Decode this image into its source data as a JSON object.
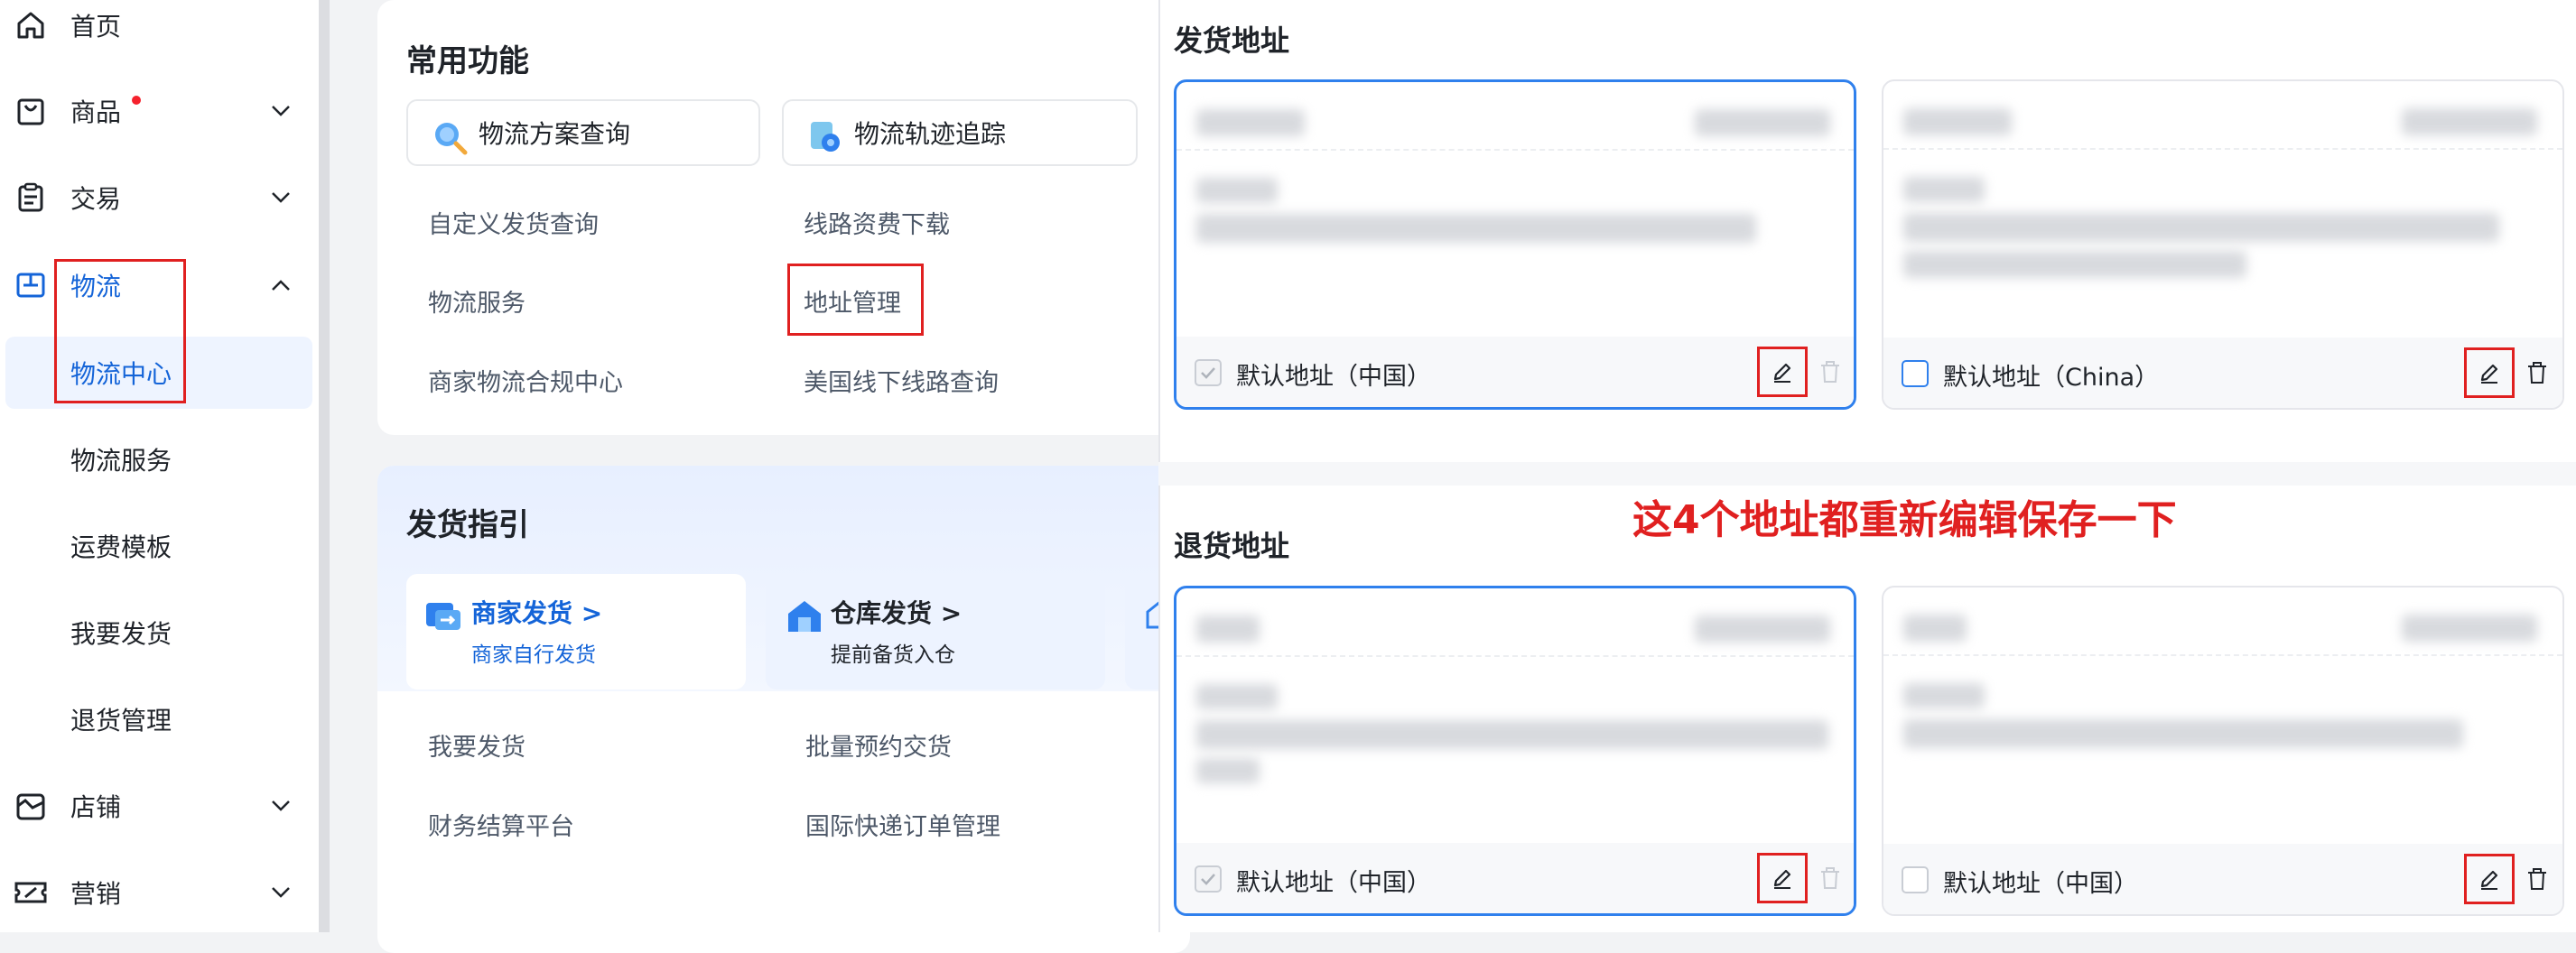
{
  "sidebar": {
    "items": [
      {
        "label": "首页",
        "icon": "home-icon"
      },
      {
        "label": "商品",
        "icon": "shopping-bag-icon",
        "has_dot": true
      },
      {
        "label": "交易",
        "icon": "clipboard-icon"
      },
      {
        "label": "物流",
        "icon": "logistics-box-icon",
        "active": true
      },
      {
        "label": "店铺",
        "icon": "store-icon"
      },
      {
        "label": "营销",
        "icon": "ticket-icon"
      }
    ],
    "logistics_sub": [
      "物流中心",
      "物流服务",
      "运费模板",
      "我要发货",
      "退货管理"
    ]
  },
  "common": {
    "title": "常用功能",
    "tools": [
      "物流方案查询",
      "物流轨迹追踪"
    ],
    "links": [
      "自定义发货查询",
      "线路资费下载",
      "物流服务",
      "地址管理",
      "商家物流合规中心",
      "美国线下线路查询"
    ]
  },
  "guide": {
    "title": "发货指引",
    "cards": [
      {
        "title": "商家发货",
        "arrow": ">",
        "sub": "商家自行发货"
      },
      {
        "title": "仓库发货",
        "arrow": ">",
        "sub": "提前备货入仓"
      }
    ],
    "links": [
      "我要发货",
      "批量预约交货",
      "财务结算平台",
      "国际快递订单管理"
    ]
  },
  "address_panel": {
    "ship_title": "发货地址",
    "return_title": "退货地址",
    "default_cn": "默认地址（中国）",
    "default_en": "默认地址（China）"
  },
  "annotation": "这4个地址都重新编辑保存一下",
  "colors": {
    "accent": "#2f80ed",
    "annotation_red": "#e02020",
    "link_blue": "#1464d8"
  }
}
